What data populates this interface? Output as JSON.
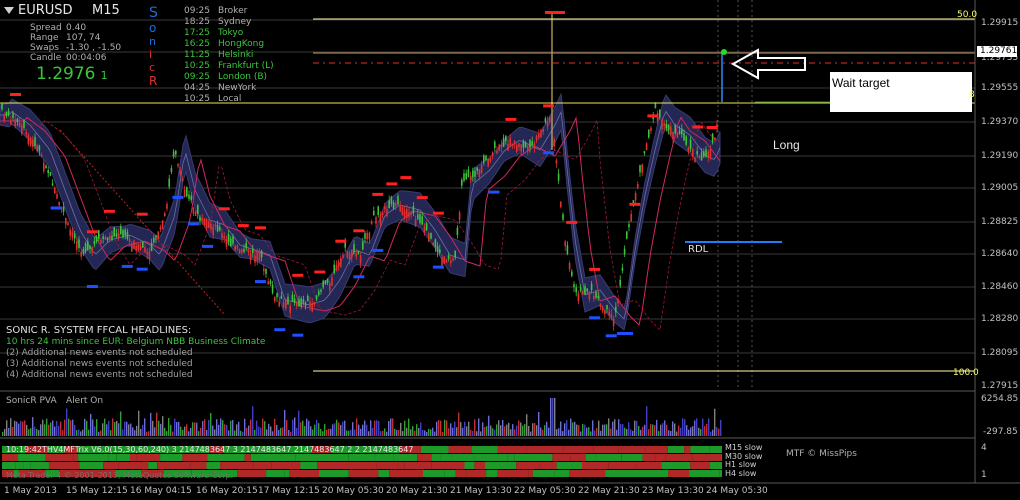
{
  "symbol": {
    "pair": "EURUSD",
    "timeframe": "M15"
  },
  "stats": [
    {
      "label": "Spread",
      "value": "0.40"
    },
    {
      "label": "Range",
      "value": "107, 74"
    },
    {
      "label": "Swaps",
      "value": "-1.30 , -1.50"
    },
    {
      "label": "Candle",
      "value": "00:04:06"
    }
  ],
  "big_price": {
    "main": "1.2976",
    "small": "1"
  },
  "sonic_letters": [
    "S",
    "o",
    "n",
    "i",
    "c",
    "R"
  ],
  "sessions": [
    {
      "time": "09:25",
      "name": "Broker",
      "color": "#b0b0b0"
    },
    {
      "time": "18:25",
      "name": "Sydney",
      "color": "#b0b0b0"
    },
    {
      "time": "17:25",
      "name": "Tokyo",
      "color": "#3cc43c"
    },
    {
      "time": "16:25",
      "name": "HongKong",
      "color": "#3cc43c"
    },
    {
      "time": "11:25",
      "name": "Helsinki",
      "color": "#3cc43c"
    },
    {
      "time": "10:25",
      "name": "Frankfurt  (L)",
      "color": "#3cc43c"
    },
    {
      "time": "09:25",
      "name": "London  (B)",
      "color": "#3cc43c"
    },
    {
      "time": "04:25",
      "name": "NewYork",
      "color": "#b0b0b0"
    },
    {
      "time": "10:25",
      "name": "Local",
      "color": "#b0b0b0"
    }
  ],
  "fib_labels": {
    "top": "50.0",
    "bottom": "100.0",
    "mid": "8"
  },
  "annotations": {
    "wait_target": "Wait target",
    "long": "Long",
    "rdl": "RDL"
  },
  "price_axis": [
    "1.29915",
    "1.29761",
    "1.29735",
    "1.29555",
    "1.29370",
    "1.29190",
    "1.29005",
    "1.28825",
    "1.28640",
    "1.28460",
    "1.28280",
    "1.28095",
    "1.27915"
  ],
  "current_price_box": "1.29761",
  "headlines": {
    "title": "SONIC R. SYSTEM  FFCAL HEADLINES:",
    "items": [
      {
        "text": "10 hrs 24 mins since EUR: Belgium NBB Business Climate",
        "color": "#3cc43c"
      },
      {
        "text": "(2)  Additional news events not scheduled",
        "color": "#a0a0a0"
      },
      {
        "text": "(3)  Additional news events not scheduled",
        "color": "#a0a0a0"
      },
      {
        "text": "(4)  Additional news events not scheduled",
        "color": "#a0a0a0"
      }
    ]
  },
  "pva_panel": {
    "title": "SonicR PVA",
    "alert": "Alert On",
    "axis": [
      "6254.85",
      "-297.85"
    ]
  },
  "mtf_panel": {
    "header": "10:19:42THV4MFTrix V6.0(15,30,60,240) 3 2147483647 3 2147483647 2147483647 2 2 2147483647",
    "footer": "Meta Trader 4  © 2001-2013, MetaQuotes Software Corp.",
    "rows": [
      "M15 slow",
      "M30 slow",
      "H1 slow",
      "H4 slow"
    ],
    "credit": "MTF © MissPips",
    "axis": [
      "4",
      "1"
    ]
  },
  "time_axis": [
    "1 May 2013",
    "15 May 12:15",
    "16 May 04:15",
    "16 May 20:15",
    "17 May 12:15",
    "20 May 05:30",
    "20 May 21:30",
    "21 May 13:30",
    "22 May 05:30",
    "22 May 21:30",
    "23 May 13:30",
    "24 May 05:30"
  ],
  "colors": {
    "bull": "#3cc43c",
    "bear": "#e03030",
    "up_marker": "#ff2020",
    "down_marker": "#1e50ff",
    "wave_fill": "#2a2e5a",
    "ema_main": "#e02878",
    "fib": "#ffffa0",
    "sonic_blue": "#1e6ed8",
    "sonic_red": "#e03030"
  }
}
